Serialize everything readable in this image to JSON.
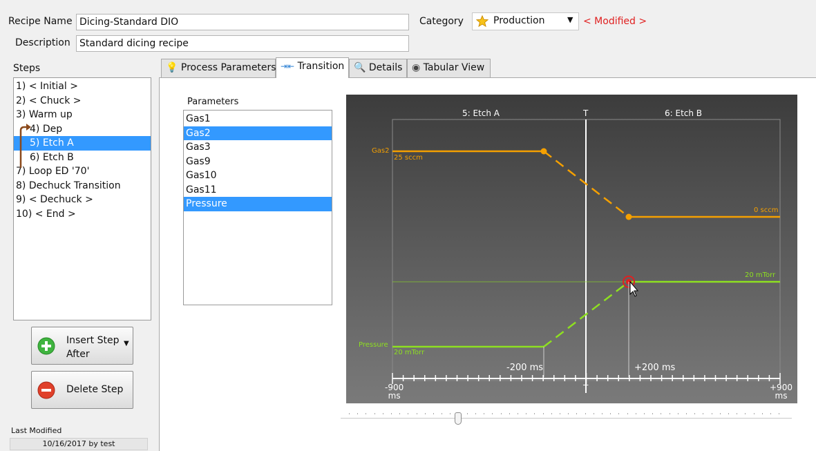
{
  "recipe": {
    "name_label": "Recipe Name",
    "name_value": "Dicing-Standard DIO",
    "description_label": "Description",
    "description_value": "Standard dicing recipe",
    "category_label": "Category",
    "category_value": "Production",
    "modified_text": "< Modified >"
  },
  "steps": {
    "label": "Steps",
    "items": [
      {
        "label": "1) < Initial >"
      },
      {
        "label": "2) < Chuck >"
      },
      {
        "label": "3) Warm up"
      },
      {
        "label": "4) Dep"
      },
      {
        "label": "5) Etch A"
      },
      {
        "label": "6) Etch B"
      },
      {
        "label": "7) Loop ED '70'"
      },
      {
        "label": "8) Dechuck Transition"
      },
      {
        "label": "9) < Dechuck >"
      },
      {
        "label": "10) < End >"
      }
    ],
    "selected_index": 4
  },
  "buttons": {
    "insert_line1": "Insert Step",
    "insert_line2": "After",
    "delete": "Delete Step"
  },
  "last_modified": {
    "label": "Last Modified",
    "value": "10/16/2017 by test"
  },
  "tabs": [
    {
      "label": "Process Parameters",
      "icon": "lightbulb-icon"
    },
    {
      "label": "Transition",
      "icon": "transition-icon"
    },
    {
      "label": "Details",
      "icon": "magnifier-icon"
    },
    {
      "label": "Tabular View",
      "icon": "eye-icon"
    }
  ],
  "active_tab": 1,
  "parameters": {
    "label": "Parameters",
    "items": [
      {
        "label": "Gas1",
        "selected": false
      },
      {
        "label": "Gas2",
        "selected": true
      },
      {
        "label": "Gas3",
        "selected": false
      },
      {
        "label": "Gas9",
        "selected": false
      },
      {
        "label": "Gas10",
        "selected": false
      },
      {
        "label": "Gas11",
        "selected": false
      },
      {
        "label": "Pressure",
        "selected": true
      }
    ]
  },
  "transition_chart": {
    "left_step": "5: Etch A",
    "right_step": "6: Etch B",
    "center_label": "T",
    "axis_left_value": "-900",
    "axis_left_unit": "ms",
    "axis_center": "T",
    "axis_right_value": "+900",
    "axis_right_unit": "ms",
    "pre_marker": "-200 ms",
    "post_marker": "+200 ms",
    "gas2": {
      "name": "Gas2",
      "start_value": "25 sccm",
      "end_value": "0 sccm",
      "color": "#f5a000"
    },
    "pressure": {
      "name": "Pressure",
      "start_value": "20 mTorr",
      "end_value": "20 mTorr",
      "color": "#8ee020"
    },
    "slider_position": 0.26
  },
  "colors": {
    "selection": "#3399ff",
    "modified": "#e02020",
    "gas2": "#f5a000",
    "pressure": "#8ee020",
    "step_arrow": "#8b4a1c"
  }
}
